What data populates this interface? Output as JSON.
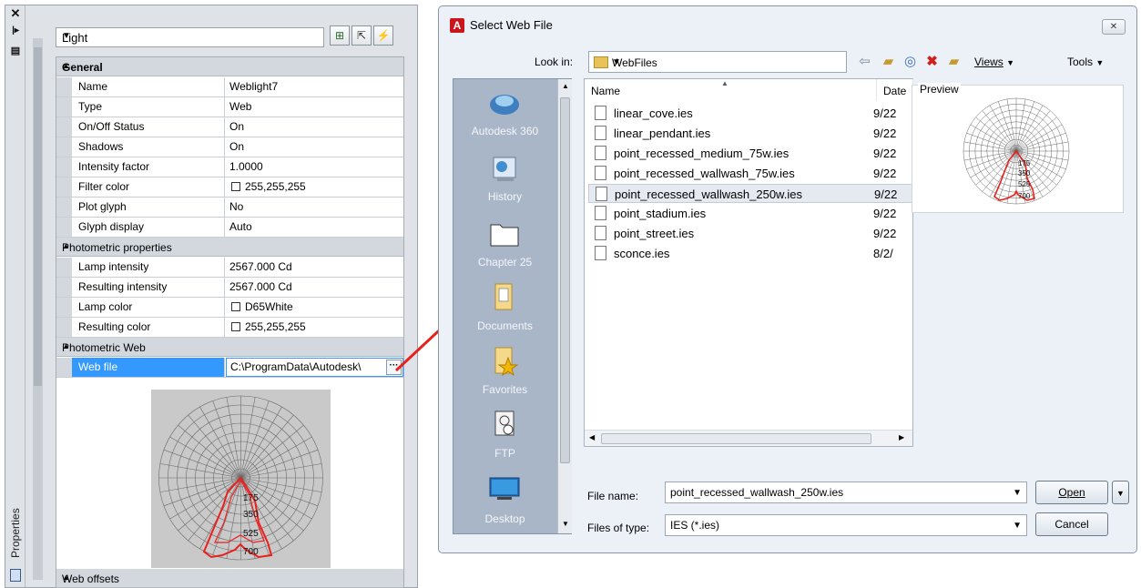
{
  "properties": {
    "close_glyph": "✕",
    "palette_title": "Properties",
    "object_type": "Light",
    "sections": {
      "general": "General",
      "photometric_properties": "Photometric properties",
      "photometric_web": "Photometric Web",
      "web_offsets": "Web offsets"
    },
    "general_rows": [
      {
        "name": "Name",
        "value": "Weblight7"
      },
      {
        "name": "Type",
        "value": "Web"
      },
      {
        "name": "On/Off Status",
        "value": "On"
      },
      {
        "name": "Shadows",
        "value": "On"
      },
      {
        "name": "Intensity factor",
        "value": "1.0000"
      },
      {
        "name": "Filter color",
        "value": "255,255,255"
      },
      {
        "name": "Plot glyph",
        "value": "No"
      },
      {
        "name": "Glyph display",
        "value": "Auto"
      }
    ],
    "photometric_rows": [
      {
        "name": "Lamp intensity",
        "value": "2567.000 Cd"
      },
      {
        "name": "Resulting intensity",
        "value": "2567.000 Cd"
      },
      {
        "name": "Lamp color",
        "value": "D65White"
      },
      {
        "name": "Resulting color",
        "value": "255,255,255"
      }
    ],
    "web_file": {
      "name": "Web file",
      "value": "C:\\ProgramData\\Autodesk\\",
      "browse": "···"
    },
    "web_plot_labels": [
      "175",
      "350",
      "525",
      "700"
    ]
  },
  "dialog": {
    "title": "Select Web File",
    "close_glyph": "✕",
    "look_in_label": "Look in:",
    "look_in_value": "WebFiles",
    "views_label": "Views",
    "tools_label": "Tools",
    "places": [
      {
        "label": "Autodesk 360"
      },
      {
        "label": "History"
      },
      {
        "label": "Chapter 25"
      },
      {
        "label": "Documents"
      },
      {
        "label": "Favorites"
      },
      {
        "label": "FTP"
      },
      {
        "label": "Desktop"
      }
    ],
    "columns": {
      "name": "Name",
      "date": "Date"
    },
    "files": [
      {
        "name": "linear_cove.ies",
        "date": "9/22"
      },
      {
        "name": "linear_pendant.ies",
        "date": "9/22"
      },
      {
        "name": "point_recessed_medium_75w.ies",
        "date": "9/22"
      },
      {
        "name": "point_recessed_wallwash_75w.ies",
        "date": "9/22"
      },
      {
        "name": "point_recessed_wallwash_250w.ies",
        "date": "9/22"
      },
      {
        "name": "point_stadium.ies",
        "date": "9/22"
      },
      {
        "name": "point_street.ies",
        "date": "9/22"
      },
      {
        "name": "sconce.ies",
        "date": "8/2/"
      }
    ],
    "selected_file_index": 4,
    "preview_label": "Preview",
    "preview_plot_labels": [
      "175",
      "350",
      "525",
      "700"
    ],
    "file_name_label": "File name:",
    "file_name_value": "point_recessed_wallwash_250w.ies",
    "files_of_type_label": "Files of type:",
    "files_of_type_value": "IES (*.ies)",
    "open_button": "Open",
    "cancel_button": "Cancel"
  },
  "colors": {
    "accent": "#3399ff",
    "arrow": "#e8211d",
    "plot_curve": "#e8211d"
  }
}
